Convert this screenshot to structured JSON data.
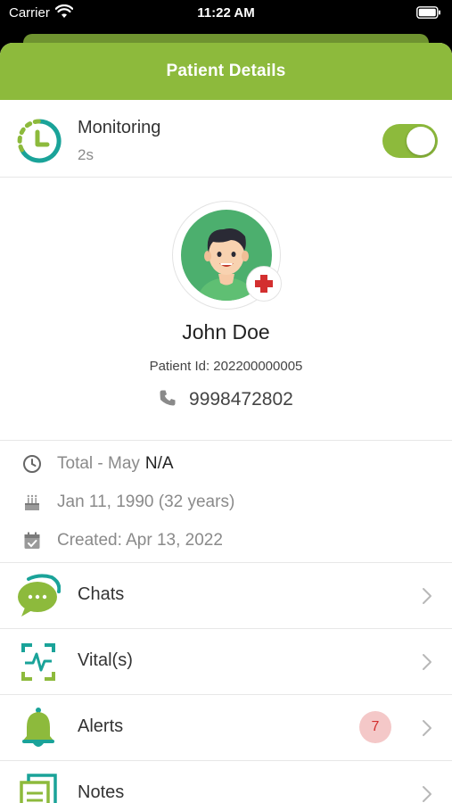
{
  "status_bar": {
    "carrier": "Carrier",
    "time": "11:22 AM"
  },
  "header": {
    "title": "Patient Details"
  },
  "monitoring": {
    "label": "Monitoring",
    "value": "2s",
    "enabled": true
  },
  "patient": {
    "name": "John Doe",
    "id_text": "Patient Id: 202200000005",
    "phone": "9998472802"
  },
  "info": {
    "total_label": "Total - May",
    "total_value": "N/A",
    "dob": "Jan 11, 1990 (32 years)",
    "created": "Created: Apr 13, 2022"
  },
  "menu": [
    {
      "label": "Chats",
      "icon": "chat-bubble-icon"
    },
    {
      "label": "Vital(s)",
      "icon": "heartbeat-monitor-icon"
    },
    {
      "label": "Alerts",
      "icon": "bell-icon",
      "badge": "7"
    },
    {
      "label": "Notes",
      "icon": "notes-icon"
    }
  ],
  "colors": {
    "accent": "#8dba3c",
    "teal": "#1aa399",
    "badge_bg": "#f4c8c8",
    "badge_text": "#d32f2f"
  }
}
